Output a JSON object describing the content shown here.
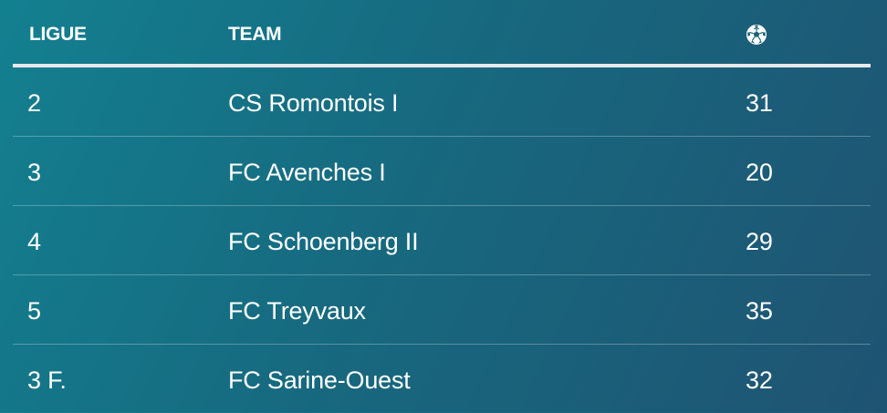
{
  "table": {
    "headers": {
      "ligue": "LIGUE",
      "team": "TEAM",
      "goals_icon": "soccer-ball-icon"
    },
    "rows": [
      {
        "ligue": "2",
        "team": "CS Romontois I",
        "goals": "31"
      },
      {
        "ligue": "3",
        "team": "FC Avenches I",
        "goals": "20"
      },
      {
        "ligue": "4",
        "team": "FC Schoenberg II",
        "goals": "29"
      },
      {
        "ligue": "5",
        "team": "FC Treyvaux",
        "goals": "35"
      },
      {
        "ligue": "3 F.",
        "team": "FC Sarine-Ouest",
        "goals": "32"
      }
    ]
  },
  "colors": {
    "background_start": "#138090",
    "background_end": "#1f5372",
    "text": "#ffffff",
    "header_rule": "#e6e9ec"
  }
}
